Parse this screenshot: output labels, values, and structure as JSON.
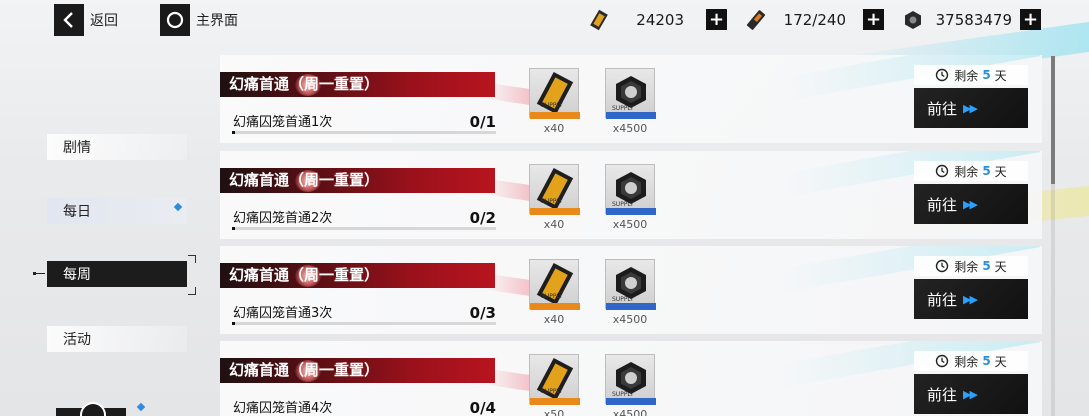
{
  "topbar": {
    "back_label": "返回",
    "home_label": "主界面",
    "resources": [
      {
        "icon": "gold-ticket-icon",
        "value": "24203"
      },
      {
        "icon": "stamina-battery-icon",
        "value": "172/240"
      },
      {
        "icon": "hex-nut-coin-icon",
        "value": "37583479"
      }
    ],
    "plus_label": "+"
  },
  "sidebar": {
    "items": [
      {
        "label": "剧情",
        "state": "normal"
      },
      {
        "label": "每日",
        "state": "normal",
        "has_notice": true
      },
      {
        "label": "每周",
        "state": "selected"
      },
      {
        "label": "活动",
        "state": "normal"
      }
    ]
  },
  "tasks": [
    {
      "title": "幻痛首通（周一重置）",
      "name": "幻痛囚笼首通1次",
      "progress": "0/1",
      "progress_fraction": 0,
      "rewards": [
        {
          "icon": "gold-ticket-icon",
          "count": "x40"
        },
        {
          "icon": "hex-nut-coin-icon",
          "count": "x4500"
        }
      ],
      "remain_prefix": "剩余",
      "remain_days": "5",
      "remain_unit": "天",
      "go_label": "前往"
    },
    {
      "title": "幻痛首通（周一重置）",
      "name": "幻痛囚笼首通2次",
      "progress": "0/2",
      "progress_fraction": 0,
      "rewards": [
        {
          "icon": "gold-ticket-icon",
          "count": "x40"
        },
        {
          "icon": "hex-nut-coin-icon",
          "count": "x4500"
        }
      ],
      "remain_prefix": "剩余",
      "remain_days": "5",
      "remain_unit": "天",
      "go_label": "前往"
    },
    {
      "title": "幻痛首通（周一重置）",
      "name": "幻痛囚笼首通3次",
      "progress": "0/3",
      "progress_fraction": 0,
      "rewards": [
        {
          "icon": "gold-ticket-icon",
          "count": "x40"
        },
        {
          "icon": "hex-nut-coin-icon",
          "count": "x4500"
        }
      ],
      "remain_prefix": "剩余",
      "remain_days": "5",
      "remain_unit": "天",
      "go_label": "前往"
    },
    {
      "title": "幻痛首通（周一重置）",
      "name": "幻痛囚笼首通4次",
      "progress": "0/4",
      "progress_fraction": 0,
      "rewards": [
        {
          "icon": "gold-ticket-icon",
          "count": "x50"
        },
        {
          "icon": "hex-nut-coin-icon",
          "count": "x4500"
        }
      ],
      "remain_prefix": "剩余",
      "remain_days": "5",
      "remain_unit": "天",
      "go_label": "前往"
    }
  ],
  "colors": {
    "accent_blue": "#2a8fdb",
    "title_red": "#b8141f",
    "dark": "#1a1a1a"
  }
}
